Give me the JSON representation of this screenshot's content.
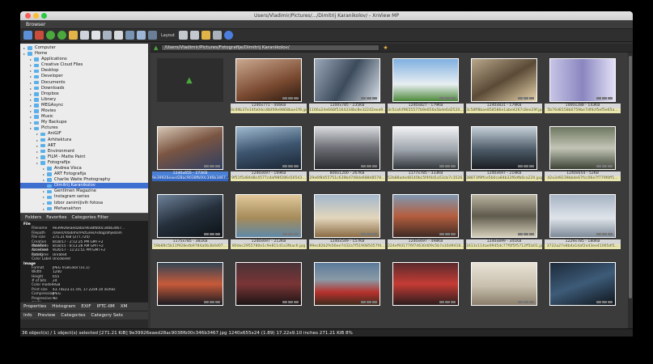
{
  "window": {
    "title": "Users/Vladimir/Pictures/.../Dimitrij Karanikolov/ - XnView MP"
  },
  "tabs": [
    "Browser"
  ],
  "toolbar": {
    "layout_label": "Layout"
  },
  "address": {
    "path": "/Users/Vladimir/Pictures/Fotografije/Dimitrij Karanikolov/"
  },
  "tree": [
    {
      "label": "Computer",
      "level": 0
    },
    {
      "label": "Home",
      "level": 0
    },
    {
      "label": "Applications",
      "level": 1
    },
    {
      "label": "Creative Cloud Files",
      "level": 1
    },
    {
      "label": "Desktop",
      "level": 1
    },
    {
      "label": "Developer",
      "level": 1
    },
    {
      "label": "Documents",
      "level": 1
    },
    {
      "label": "Downloads",
      "level": 1
    },
    {
      "label": "Dropbox",
      "level": 1
    },
    {
      "label": "Library",
      "level": 1
    },
    {
      "label": "MEGAsync",
      "level": 1
    },
    {
      "label": "Movies",
      "level": 1
    },
    {
      "label": "Music",
      "level": 1
    },
    {
      "label": "My Backupe",
      "level": 1
    },
    {
      "label": "Pictures",
      "level": 1
    },
    {
      "label": "AniGIF",
      "level": 2
    },
    {
      "label": "Arhitektura",
      "level": 2
    },
    {
      "label": "ART",
      "level": 2
    },
    {
      "label": "Environment",
      "level": 2
    },
    {
      "label": "FILM - Matte Paint",
      "level": 2
    },
    {
      "label": "Fotografije",
      "level": 2
    },
    {
      "label": "Andrea Visca",
      "level": 3
    },
    {
      "label": "ART Fotografija",
      "level": 3
    },
    {
      "label": "Charlie Waite Photography",
      "level": 3
    },
    {
      "label": "Dimitrij Karanikolov",
      "level": 3,
      "selected": true
    },
    {
      "label": "Gentlmen Magazine",
      "level": 3
    },
    {
      "label": "Instagram series",
      "level": 3
    },
    {
      "label": "Izbor zanimljivih fotosa",
      "level": 3
    },
    {
      "label": "Mehanakhon",
      "level": 3
    }
  ],
  "left_tabs": [
    "Folders",
    "Favorites",
    "Categories Filter"
  ],
  "properties": [
    {
      "section": "File"
    },
    {
      "k": "Filename",
      "v": "9e39926eaed28ac9038fb00c346b3467..."
    },
    {
      "k": "Filepath",
      "v": "/Users/Vladimir/Pictures/Fotografije/Dim"
    },
    {
      "k": "File size",
      "v": "271.21 KiB (277,724)"
    },
    {
      "k": "Creation date/time",
      "v": "8/18/17 - 2:12:25 PM GMT+2"
    },
    {
      "k": "Modified date/time",
      "v": "8/18/15 - 8:13:28 AM GMT+2"
    },
    {
      "k": "Accessed date/time",
      "v": "9/26/17 - 11:21:51 PM GMT+2"
    },
    {
      "k": "Rating",
      "v": "Unrated"
    },
    {
      "k": "Color Label",
      "v": "Uncolored"
    },
    {
      "section": "Image"
    },
    {
      "k": "Format",
      "v": "JPEG TrueColor (v1.1)"
    },
    {
      "k": "Width",
      "v": "1240"
    },
    {
      "k": "Height",
      "v": "655"
    },
    {
      "k": "# of bits",
      "v": "24"
    },
    {
      "k": "Color model",
      "v": "RGB"
    },
    {
      "k": "Print size",
      "v": "43.74x23.11 cm, 17.22x9.10 inches"
    },
    {
      "k": "Compression",
      "v": "JPEG"
    },
    {
      "k": "Progressive mode",
      "v": "No"
    }
  ],
  "bottom_tabs_row1": [
    "Properties",
    "Histogram",
    "EXIF",
    "IPTC-IIM",
    "XM"
  ],
  "bottom_tabs_row2": [
    "Info",
    "Preview",
    "Categories",
    "Category Sets"
  ],
  "thumbnails": [
    {
      "size": "",
      "hash": "",
      "bg": "#2d2d2d",
      "folder": true
    },
    {
      "size": "1240x771 - 406KB",
      "hash": "0c09b37e14fa0dcc8bf49e9868bae1f9.jpg",
      "bg": "linear-gradient(160deg,#caa890,#7a4a30 60%,#2a1a12)"
    },
    {
      "size": "1200x785 - 235KB",
      "hash": "1166a24e668f5164334bc8e32242eea9...",
      "bg": "linear-gradient(120deg,#9aa7b8,#3c4b5c 50%,#d9e1ea)"
    },
    {
      "size": "1240x827 - 179KB",
      "hash": "3c5cafcf9655577b9e656a5bde6d2520...",
      "bg": "linear-gradient(180deg,#7fb0e0,#e8eef2 60%,#4c8a3a)"
    },
    {
      "size": "1240x831 - 179KB",
      "hash": "3c58ff8bae858586e1abe4267c8ee29f.jpg",
      "bg": "linear-gradient(150deg,#b8a78a,#5b4a36 50%,#e7d4ad)"
    },
    {
      "size": "1000x288 - 143KB",
      "hash": "5b76d8158b0759be7df4cf5ef5e65a...",
      "bg": "linear-gradient(90deg,#c7c4e6,#8a86c0 50%,#e2e0f6)"
    },
    {
      "size": "1240x655 - 272KB",
      "hash": "9e39926eaed28ac9038fb00c346b3467...",
      "bg": "linear-gradient(160deg,#d6c6b4,#7a5542 45%,#2d3e63)",
      "selected": true
    },
    {
      "size": "1240x697 - 169KB",
      "hash": "9f51f5d84d8c4577cdaf98f286d16543...",
      "bg": "linear-gradient(170deg,#9eb9cf,#3e5670 50%,#1a2533)"
    },
    {
      "size": "800x1200 - 267KB",
      "hash": "29e6f8d55751c639bd748de688d8578...",
      "bg": "linear-gradient(180deg,#d6d8dc,#6b6e74 50%,#2a2b30)"
    },
    {
      "size": "1177x785 - 333KB",
      "hash": "52b88aded8140bc5f4f4d1a53cb7c3526...",
      "bg": "linear-gradient(180deg,#f0f2f4,#9ca3aa 55%,#30363a)"
    },
    {
      "size": "1240x697 - 219KB",
      "hash": "38873f9ffce5b0ca84b32f6dfb0ca220.jpg",
      "bg": "linear-gradient(180deg,#c4cfd8,#4b5966 55%,#1a1d22)"
    },
    {
      "size": "1240x654 - 52KB",
      "hash": "42a3d9239bbde67fcc06e7f779f0ff1...",
      "bg": "linear-gradient(180deg,#6d7760,#c3c6b6 50%,#3d4537)"
    },
    {
      "size": "1175x785 - 381KB",
      "hash": "59b89c5b11f928e4b9784a0b3b0d07...",
      "bg": "linear-gradient(160deg,#6e8199,#25303c 50%,#0c1116)"
    },
    {
      "size": "1240x697 - 212KB",
      "hash": "80dec2955780e1c9e811d1a3fbac6.jpg",
      "bg": "linear-gradient(180deg,#e1c89a,#a58b5a 55%,#5e89a8)"
    },
    {
      "size": "1240x549 - 157KB",
      "hash": "99ec82b2fe56ee7d32a7f519085057fd...",
      "bg": "linear-gradient(180deg,#a4b8cc,#e3d6bc 55%,#8a6c44)"
    },
    {
      "size": "1240x697 - 498KB",
      "hash": "224ef931776f74630d09c5b7a16d9418...",
      "bg": "linear-gradient(180deg,#7f98b2,#b55e3f 50%,#3e2a23)"
    },
    {
      "size": "1240x899 - 341KB",
      "hash": "1613c114ae0945dc77f0f5f5712ff1b01.jpg",
      "bg": "linear-gradient(180deg,#b9b2a0,#5e5a4c 50%,#d4ceb8)"
    },
    {
      "size": "1229x785 - 180KB",
      "hash": "3722a27e8b4a1daf2e43ee41065df1...",
      "bg": "linear-gradient(180deg,#a6b3c3,#dfe4ea 55%,#7e8a98)"
    },
    {
      "size": "",
      "hash": "",
      "bg": "linear-gradient(180deg,#334455,#c65a3a 50%,#1a1a22)"
    },
    {
      "size": "",
      "hash": "",
      "bg": "linear-gradient(180deg,#4a3338,#7a3536 50%,#1d1516)"
    },
    {
      "size": "",
      "hash": "",
      "bg": "linear-gradient(180deg,#5b7a9a,#8a9aa6 40%,#b7312c 70%,#3d2b1c)"
    },
    {
      "size": "",
      "hash": "",
      "bg": "linear-gradient(180deg,#5a2b2d,#c53b34 50%,#2b1d1d)"
    },
    {
      "size": "",
      "hash": "",
      "bg": "linear-gradient(180deg,#e9e3d6,#c8bfae 55%,#8a7e6a)"
    },
    {
      "size": "",
      "hash": "",
      "bg": "linear-gradient(160deg,#1d2a3a,#3d5b78 50%,#0e141b)"
    }
  ],
  "status": {
    "text": "36 object(s) / 1 object(s) selected [271.21 KiB]  9e39926eaed28ac9038fb00c346b3467.jpg  1240x655x24 (1.89)  17.22x9.10 inches  271.21 KiB  8%"
  }
}
